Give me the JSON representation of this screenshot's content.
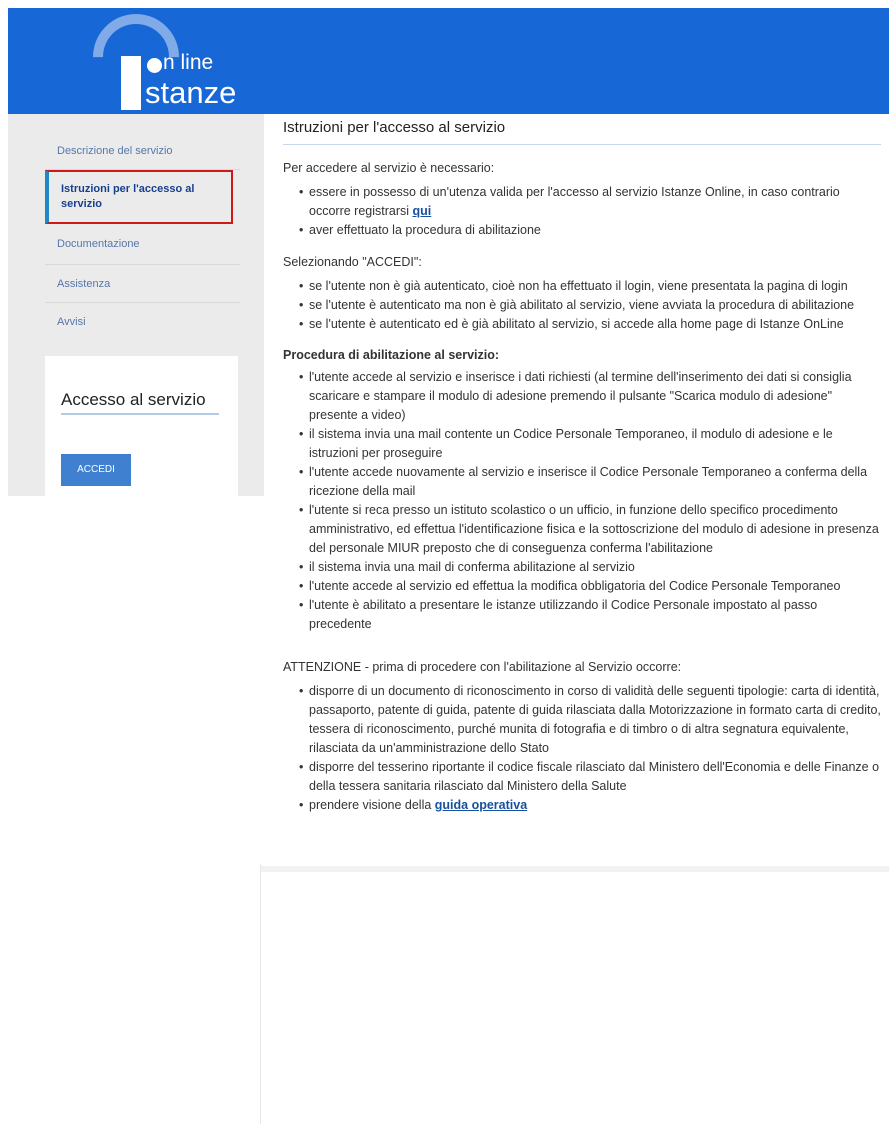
{
  "header": {
    "logo_line1": "n line",
    "logo_line2": "stanze",
    "brand_color": "#1767d6"
  },
  "sidebar": {
    "items": [
      {
        "label": "Descrizione del servizio"
      },
      {
        "label": "Istruzioni per l'accesso al servizio"
      },
      {
        "label": "Documentazione"
      },
      {
        "label": "Assistenza"
      },
      {
        "label": "Avvisi"
      }
    ],
    "active_index": 1
  },
  "access_box": {
    "title": "Accesso al servizio",
    "button_label": "ACCEDI"
  },
  "main": {
    "title": "Istruzioni per l'accesso al servizio",
    "intro": "Per accedere al servizio è necessario:",
    "requirements": {
      "item1_text": "essere in possesso di un'utenza valida per l'accesso al servizio Istanze Online, in caso contrario occorre registrarsi ",
      "item1_link": "qui",
      "item2": "aver effettuato la procedura di abilitazione"
    },
    "selecting": "Selezionando \"ACCEDI\":",
    "selecting_items": [
      "se l'utente non è già autenticato, cioè non ha effettuato il login, viene presentata la pagina di login",
      "se l'utente è autenticato ma non è già abilitato al servizio, viene avviata la procedura di abilitazione",
      "se l'utente è autenticato ed è già abilitato al servizio, si accede alla home page di Istanze OnLine"
    ],
    "procedure_heading": "Procedura di abilitazione al servizio:",
    "procedure_items": [
      "l'utente accede al servizio e inserisce i dati richiesti (al termine dell'inserimento dei dati si consiglia scaricare e stampare il modulo di adesione premendo il pulsante \"Scarica modulo di adesione\" presente a video)",
      "il sistema invia una mail contente un Codice Personale Temporaneo, il modulo di adesione e le istruzioni per proseguire",
      "l'utente accede nuovamente al servizio e inserisce il Codice Personale Temporaneo a conferma della ricezione della mail",
      "l'utente si reca presso un istituto scolastico o un ufficio, in funzione dello specifico procedimento amministrativo, ed effettua l'identificazione fisica e la sottoscrizione del modulo di adesione in presenza del personale MIUR preposto che di conseguenza conferma l'abilitazione",
      "il sistema invia una mail di conferma abilitazione al servizio",
      "l'utente accede al servizio ed effettua la modifica obbligatoria del Codice Personale Temporaneo",
      "l'utente è abilitato a presentare le istanze utilizzando il Codice Personale impostato al passo precedente"
    ],
    "attention": "ATTENZIONE - prima di procedere con l'abilitazione al Servizio occorre:",
    "attention_items": [
      "disporre di un documento di riconoscimento in corso di validità delle seguenti tipologie: carta di identità, passaporto, patente di guida, patente di guida rilasciata dalla Motorizzazione in formato carta di credito, tessera di riconoscimento, purché munita di fotografia e di timbro o di altra segnatura equivalente, rilasciata da un'amministrazione dello Stato",
      "disporre del tesserino riportante il codice fiscale rilasciato dal Ministero dell'Economia e delle Finanze o della tessera sanitaria rilasciato dal Ministero della Salute"
    ],
    "attention_last_text": "prendere visione della ",
    "attention_last_link": "guida operativa"
  }
}
